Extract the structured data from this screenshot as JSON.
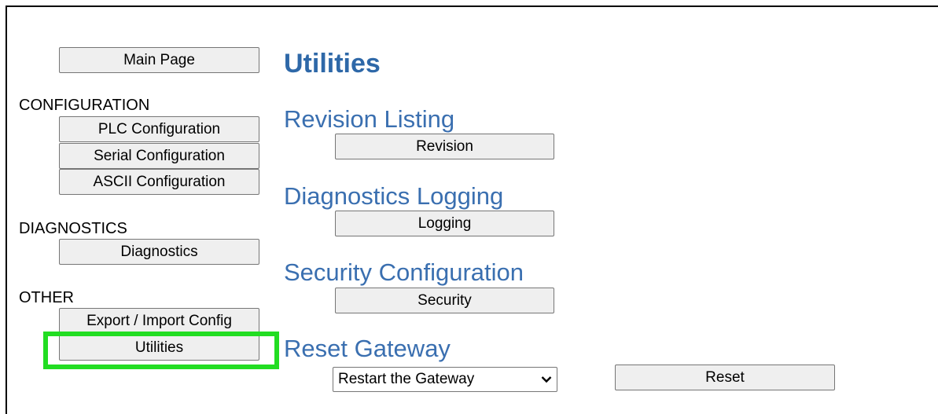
{
  "nav": {
    "main_page": "Main Page",
    "sections": {
      "configuration": "CONFIGURATION",
      "diagnostics": "DIAGNOSTICS",
      "other": "OTHER"
    },
    "items": {
      "plc_configuration": "PLC Configuration",
      "serial_configuration": "Serial Configuration",
      "ascii_configuration": "ASCII Configuration",
      "diagnostics": "Diagnostics",
      "export_import_config": "Export / Import Config",
      "utilities": "Utilities"
    },
    "highlighted_item": "Utilities",
    "highlight_color": "#22dd22"
  },
  "main": {
    "title": "Utilities",
    "revision": {
      "heading": "Revision Listing",
      "button": "Revision"
    },
    "logging": {
      "heading": "Diagnostics Logging",
      "button": "Logging"
    },
    "security": {
      "heading": "Security Configuration",
      "button": "Security"
    },
    "reset": {
      "heading": "Reset Gateway",
      "select_value": "Restart the Gateway",
      "button": "Reset"
    }
  },
  "colors": {
    "title": "#2e68a8",
    "heading": "#3a6fb0",
    "button_bg": "#efefef"
  }
}
